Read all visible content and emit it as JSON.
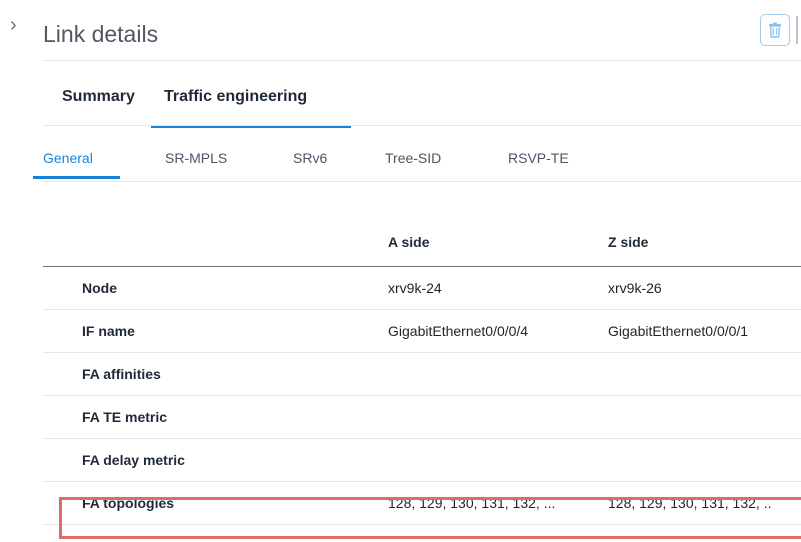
{
  "header": {
    "title": "Link details",
    "delete_icon": "trash-icon",
    "collapse_icon": "chevron-right-icon"
  },
  "tabs_primary": [
    {
      "label": "Summary"
    },
    {
      "label": "Traffic engineering",
      "active": true
    }
  ],
  "tabs_secondary": [
    {
      "label": "General",
      "active": true
    },
    {
      "label": "SR-MPLS"
    },
    {
      "label": "SRv6"
    },
    {
      "label": "Tree-SID"
    },
    {
      "label": "RSVP-TE"
    }
  ],
  "table": {
    "columns": [
      "",
      "A side",
      "Z side"
    ],
    "rows": [
      {
        "label": "Node",
        "a": "xrv9k-24",
        "z": "xrv9k-26"
      },
      {
        "label": "IF name",
        "a": "GigabitEthernet0/0/0/4",
        "z": "GigabitEthernet0/0/0/1"
      },
      {
        "label": "FA affinities",
        "a": "",
        "z": ""
      },
      {
        "label": "FA TE metric",
        "a": "",
        "z": ""
      },
      {
        "label": "FA delay metric",
        "a": "",
        "z": ""
      },
      {
        "label": "FA topologies",
        "a": "128, 129, 130, 131, 132, ...",
        "z": "128, 129, 130, 131, 132, .."
      }
    ]
  },
  "colors": {
    "accent": "#1683d8",
    "highlight_border": "#e06b64"
  }
}
